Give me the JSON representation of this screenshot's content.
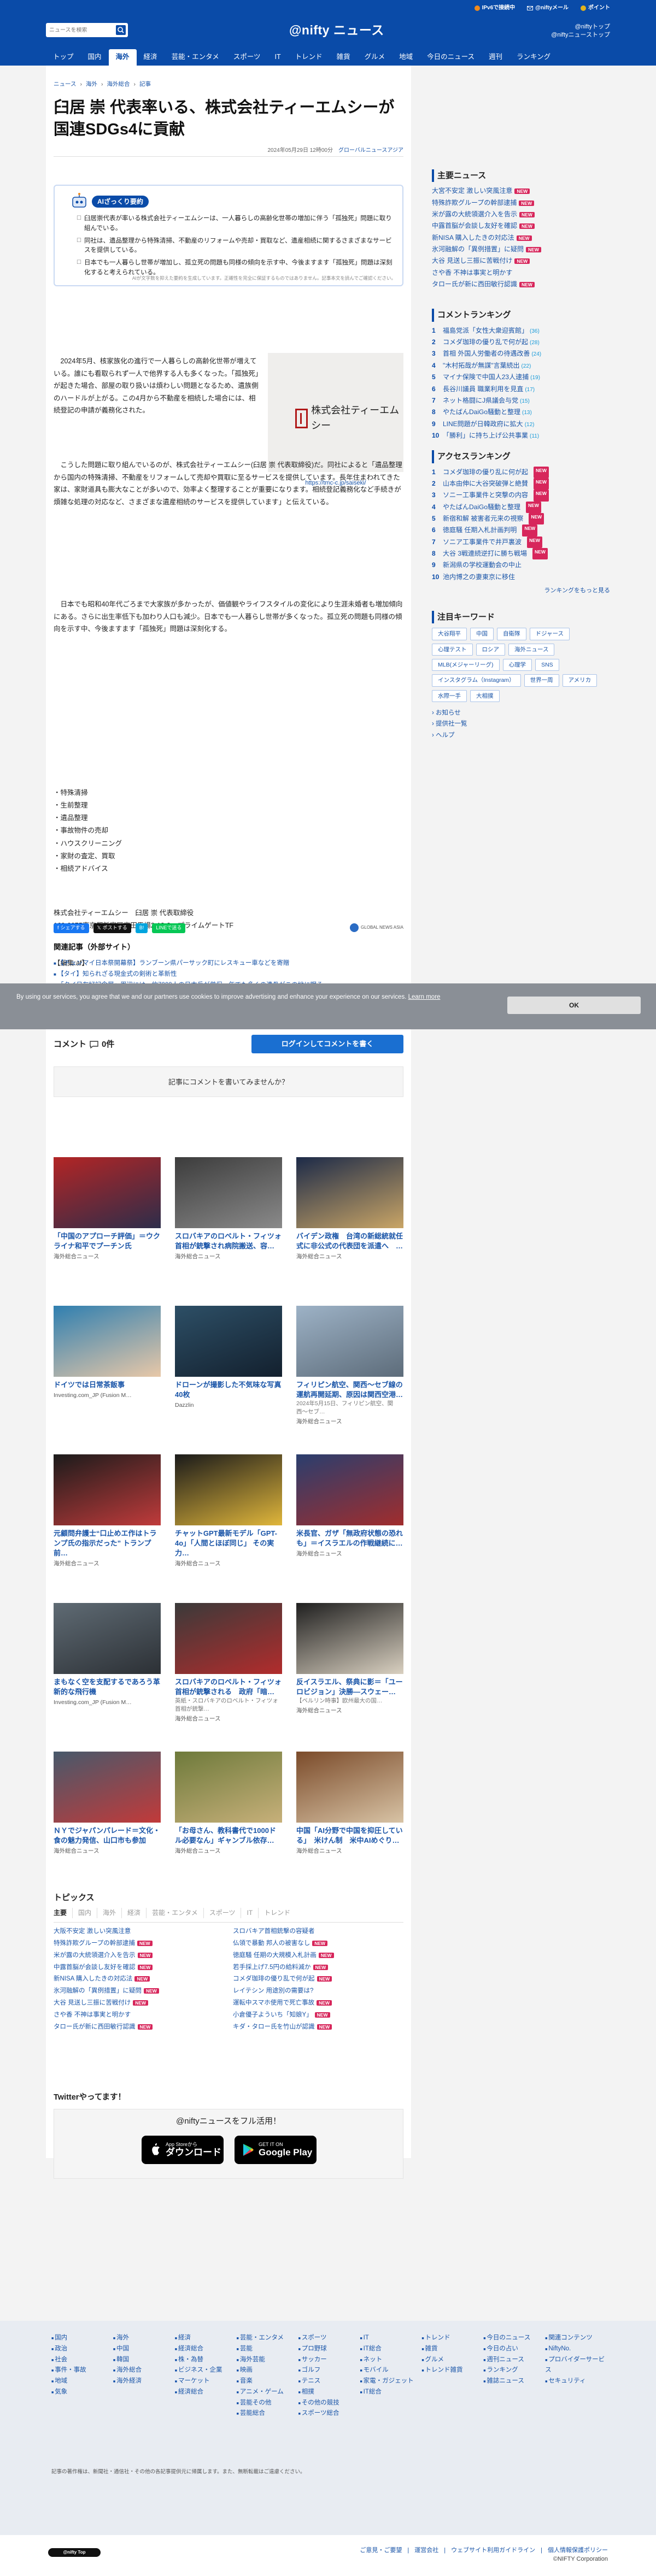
{
  "header": {
    "util": [
      "IPv6で接続中",
      "@niftyメール",
      "ポイント"
    ],
    "search_placeholder": "ニュースを検索",
    "logo": "@nifty ニュース",
    "links": [
      "@niftyトップ",
      "@niftyニューストップ"
    ],
    "nav": [
      "トップ",
      "国内",
      "海外",
      "経済",
      "芸能・エンタメ",
      "スポーツ",
      "IT",
      "トレンド",
      "雑貨",
      "グルメ",
      "地域",
      "今日のニュース",
      "週刊",
      "ランキング"
    ],
    "nav_active_index": 2
  },
  "breadcrumb": [
    "ニュース",
    "海外",
    "海外総合",
    "記事"
  ],
  "article": {
    "title": "臼居 崇 代表率いる、株式会社ティーエムシーが国連SDGs4に貢献",
    "date": "2024年05月29日 12時00分",
    "source": "グローバルニュースアジア",
    "summary_label": "AIざっくり要約",
    "summary": [
      "臼居崇代表が率いる株式会社ティーエムシーは、一人暮らしの高齢化世帯の増加に伴う「孤独死」問題に取り組んでいる。",
      "同社は、遺品整理から特殊清掃、不動産のリフォームや売却・買取など、遺産相続に関するさまざまなサービスを提供している。",
      "日本でも一人暮らし世帯が増加し、孤立死の問題も同様の傾向を示す中、今後ますます「孤独死」問題は深刻化すると考えられている。"
    ],
    "summary_note": "AIが文字数を抑えた要約を生成しています。正確性を完全に保証するものではありません。記事本文を読んでご確認ください。",
    "para1": "2024年5月、核家族化の進行で一人暮らしの高齢化世帯が増えている。誰にも看取られず一人で他界する人も多くなった。「孤独死」が起きた場合、部屋の取り扱いは煩わしい問題となるため、遺族側のハードルが上がる。この4月から不動産を相続した場合には、相続登記の申請が義務化された。",
    "para2": "こうした問題に取り組んでいるのが、株式会社ティーエムシー(臼居 崇 代表取締役)だ。同社によると「遺品整理から国内の特殊清掃、不動産をリフォームして売却や買取に至るサービスを提供しています。長年住まわれてきた家は、家財道具も膨大なことが多いので、効率よく整理することが重要になります。相続登記義務化など手続きが煩雑な処理の対応など、さまざまな遺産相続のサービスを提供しています」と伝えている。",
    "para3": "日本でも昭和40年代ごろまで大家族が多かったが、価値観やライフスタイルの変化により生涯未婚者も増加傾向にある。さらに出生率低下も加わり人口も減少。日本でも一人暮らし世帯が多くなった。孤立死の問題も同様の傾向を示す中、今後ますます「孤独死」問題は深刻化する。",
    "figure_name": "株式会社ティーエムシー",
    "figure_caption": "https://tmc-c.jp/saiseki/",
    "bullets": [
      "特殊清掃",
      "生前整理",
      "遺品整理",
      "事故物件の売却",
      "ハウスクリーニング",
      "家財の査定、買取",
      "相続アドバイス"
    ],
    "company": [
      "株式会社ティーエムシー　臼居 崇 代表取締役",
      "169-0075東京都新宿区高田馬場2-13-2　プライムゲートTF"
    ],
    "editor": "【編集:af】"
  },
  "social": [
    "シェアする",
    "ポストする",
    "B!",
    "LINEで送る"
  ],
  "social_partner": "GLOBAL NEWS ASIA",
  "related": {
    "heading": "関連記事（外部サイト）",
    "items": [
      "【チュンマイ日本祭開幕祭】ランブーン県パーサック町にレスキュー車などを寄贈",
      "【タイ】知られざる現金式の剣術と革新性",
      "「タイ日友好記念展」周辺には、約7000人の日本兵が僧侶一年でも多くの遺骨がこの地に眠る"
    ]
  },
  "cookie": {
    "text": "By using our services, you agree that we and our partners use cookies to improve advertising and enhance your experience on our services.",
    "learn": "Learn more",
    "ok": "OK"
  },
  "comments": {
    "title": "コメント",
    "count": "0件",
    "button": "ログインしてコメントを書く",
    "empty": "記事にコメントを書いてみませんか？"
  },
  "tiles": [
    {
      "caption": "「中国のアプローチ評価」＝ウクライナ和平でプーチン氏",
      "sub": "",
      "source": "海外総合ニュース"
    },
    {
      "caption": "スロバキアのロベルト・フィツォ首相が銃撃され病院搬送、容…",
      "sub": "",
      "source": "海外総合ニュース"
    },
    {
      "caption": "バイデン政権　台湾の新総統就任式に非公式の代表団を派遣へ　…",
      "sub": "",
      "source": "海外総合ニュース"
    },
    {
      "caption": "ドイツでは日常茶飯事",
      "sub": "",
      "source": "Investing.com_JP (Fusion M…"
    },
    {
      "caption": "ドローンが撮影した不気味な写真40枚",
      "sub": "",
      "source": "Dazzlin"
    },
    {
      "caption": "フィリピン航空、関西〜セブ線の運航再開延期、原因は関西空港…",
      "sub": "2024年5月15日、フィリピン航空、関西〜セブ…",
      "source": "海外総合ニュース"
    },
    {
      "caption": "元顧問弁護士“口止めエ作はトランプ氏の指示だった” トランプ前…",
      "sub": "",
      "source": "海外総合ニュース"
    },
    {
      "caption": "チャットGPT最新モデル「GPT-4o」「人間とほぼ同じ」 その実力…",
      "sub": "",
      "source": "海外総合ニュース"
    },
    {
      "caption": "米長官、ガザ「無政府状態の恐れも」＝イスラエルの作戦継続に…",
      "sub": "",
      "source": "海外総合ニュース"
    },
    {
      "caption": "まもなく空を支配するであろう革新的な飛行機",
      "sub": "",
      "source": "Investing.com_JP (Fusion M…"
    },
    {
      "caption": "スロバキアのロベルト・フィツォ首相が銃撃される　政府「暗…",
      "sub": "英紙・スロバキアのロベルト・フィツォ首相が銃撃…",
      "source": "海外総合ニュース"
    },
    {
      "caption": "反イスラエル、祭典に影＝「ユーロビジョン」決勝―スウェー…",
      "sub": "【ベルリン時事】欧州最大の国…",
      "source": "海外総合ニュース"
    },
    {
      "caption": "ＮＹでジャパンパレード＝文化・食の魅力発信、山口市も参加",
      "sub": "",
      "source": "海外総合ニュース"
    },
    {
      "caption": "「お母さん、教科書代で1000ドル必要なん」ギャンブル依存…",
      "sub": "",
      "source": "海外総合ニュース"
    },
    {
      "caption": "中国「AI分野で中国を抑圧している」　米けん制　米中AIめぐり…",
      "sub": "",
      "source": "海外総合ニュース"
    }
  ],
  "topics": {
    "heading": "トピックス",
    "tabs": [
      "主要",
      "国内",
      "海外",
      "経済",
      "芸能・エンタメ",
      "スポーツ",
      "IT",
      "トレンド"
    ],
    "left": [
      "大阪不安定 激しい突風注意",
      "特殊詐欺グループの幹部逮捕",
      "米が露の大統領選介入を告示",
      "中露首脳が会談し友好を確認",
      "新NISA 購入したきの対応法",
      "氷河融解の「異例措置」に疑問",
      "大谷 見送し三振に苦戦付け",
      "さや香 不神は事実と明かす",
      "タロー氏が新に西田敏行認識"
    ],
    "left_new": [
      false,
      true,
      true,
      true,
      true,
      true,
      true,
      false,
      true
    ],
    "right": [
      "スロバキア首相銃撃の容疑者",
      "仏領で暴動 邦人の被害なし",
      "徳庭騒 任期の大規模入札計画",
      "若手採上げ7.5円の給料減か",
      "コメダ珈琲の優り乱で何が起",
      "レイテシン 用途別の需要は?",
      "運転中スマホ使用で死亡事故",
      "小倉優子よういち「知娘Y」",
      "キダ・タロー氏を竹山が認識"
    ],
    "right_new": [
      false,
      true,
      true,
      true,
      true,
      false,
      true,
      true,
      true
    ],
    "twitter": "Twitterやってます！"
  },
  "app": {
    "heading": "@niftyニュースをフル活用！",
    "appstore_small": "App Storeから",
    "appstore_big": "ダウンロード",
    "google_small": "GET IT ON",
    "google_big": "Google Play"
  },
  "sidebar": {
    "main_news_heading": "主要ニュース",
    "main_news": [
      "大宮不安定 激しい突風注意",
      "特殊詐欺グループの幹部逮捕",
      "米が露の大統領選介入を告示",
      "中露首脳が会談し友好を確認",
      "新NISA 購入したきの対応法",
      "氷河融解の「異例措置」に疑問",
      "大谷 見送し三振に苦戦付け",
      "さや香 不神は事実と明かす",
      "タロー氏が新に西田敏行認識"
    ],
    "main_news_new": [
      true,
      true,
      true,
      true,
      true,
      true,
      true,
      false,
      true
    ],
    "comment_ranking_heading": "コメントランキング",
    "comment_ranking": [
      "福島党派「女性大衆迎賓館」",
      "コメダ珈琲の優り乱で何が起",
      "首相 外国人労働者の待遇改善",
      "\"木村拓哉が無謀\"言葉続出",
      "マイナ保険で中国人23人逮捕",
      "長谷川議員 職業利用を見直",
      "ネット格闘にJ県議会与党",
      "やたばんDaiGo騒動と整理",
      "LINE問題が日韓政府に拡大",
      "「勝利」に持ち上げ公共事業"
    ],
    "comment_ranking_count": [
      "(36)",
      "(28)",
      "(24)",
      "(22)",
      "(19)",
      "(17)",
      "(15)",
      "(13)",
      "(12)",
      "(11)"
    ],
    "access_ranking_heading": "アクセスランキング",
    "access_ranking": [
      "コメダ珈琲の優り乱に何が起",
      "山本由伸に大谷突破弾と絶賛",
      "ソニー工事業件と突撃の内容",
      "やたばんDaiGo騒動と整理",
      "新宿和解 被害者元来の視察",
      "徳庭騒 任期入札計画判明",
      "ソニア工事業件で井戸裏波",
      "大谷 3戦連続逆打に勝ち戦場",
      "新潟県の学校運動会の中止",
      "池内博之の妻東京に移住"
    ],
    "access_new": [
      true,
      true,
      true,
      true,
      true,
      true,
      true,
      true,
      false,
      false
    ],
    "more": "ランキングをもっと見る",
    "keywords_heading": "注目キーワード",
    "keywords": [
      "大谷翔平",
      "中国",
      "自衛隊",
      "ドジャース",
      "心理テスト",
      "ロシア",
      "海外ニュース",
      "MLB(メジャーリーグ)",
      "心理学",
      "SNS",
      "インスタグラム（Instagram）",
      "世界一周",
      "アメリカ",
      "水際一手",
      "大相撲"
    ],
    "notices": [
      "お知らせ",
      "提供社一覧",
      "ヘルプ"
    ]
  },
  "footer": {
    "cols": [
      [
        "国内",
        "政治",
        "社会",
        "事件・事故",
        "地域",
        "気象"
      ],
      [
        "海外",
        "中国",
        "韓国",
        "海外総合",
        "海外経済"
      ],
      [
        "経済",
        "経済総合",
        "株・為替",
        "ビジネス・企業",
        "マーケット",
        "経済総合"
      ],
      [
        "芸能・エンタメ",
        "芸能",
        "海外芸能",
        "映画",
        "音楽",
        "アニメ・ゲーム",
        "芸能その他",
        "芸能総合"
      ],
      [
        "スポーツ",
        "プロ野球",
        "サッカー",
        "ゴルフ",
        "テニス",
        "相撲",
        "その他の競技",
        "スポーツ総合"
      ],
      [
        "IT",
        "IT総合",
        "ネット",
        "モバイル",
        "家電・ガジェット",
        "IT総合"
      ],
      [
        "トレンド",
        "雑貨",
        "グルメ",
        "トレンド雑貨"
      ],
      [
        "今日のニュース",
        "今日の占い",
        "週刊ニュース",
        "ランキング",
        "雑誌ニュース"
      ],
      [
        "関連コンテンツ",
        "NiftyNo.",
        "プロバイダーサービス",
        "セキュリティ"
      ]
    ],
    "note": "記事の著作権は、新聞社・通信社・その他の各記事提供元に帰属します。また、無断転載はご遠慮ください。",
    "logo": "@nifty Top",
    "links": [
      "ご意見・ご要望",
      "運営会社",
      "ウェブサイト利用ガイドライン",
      "個人情報保護ポリシー"
    ],
    "copyright": "©NIFTY Corporation"
  }
}
